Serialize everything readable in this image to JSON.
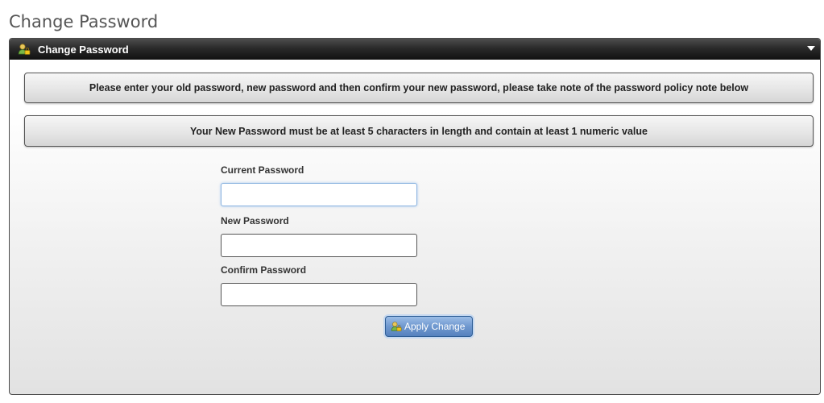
{
  "page": {
    "title": "Change Password"
  },
  "panel": {
    "header_title": "Change Password",
    "header_icon": "lock-user-icon",
    "collapse_icon": "triangle-down-icon"
  },
  "notices": [
    "Please enter your old password, new password and then confirm your new password, please take note of the password policy note below",
    "Your New Password must be at least 5 characters in length and contain at least 1 numeric value"
  ],
  "form": {
    "fields": [
      {
        "label": "Current Password",
        "value": "",
        "focused": true
      },
      {
        "label": "New Password",
        "value": ""
      },
      {
        "label": "Confirm Password",
        "value": ""
      }
    ],
    "submit_label": "Apply Change",
    "submit_icon": "lock-user-icon"
  },
  "colors": {
    "header_bg": "#1a1a1a",
    "button_blue": "#6f98cf",
    "focus_border": "#8cb4e0"
  }
}
